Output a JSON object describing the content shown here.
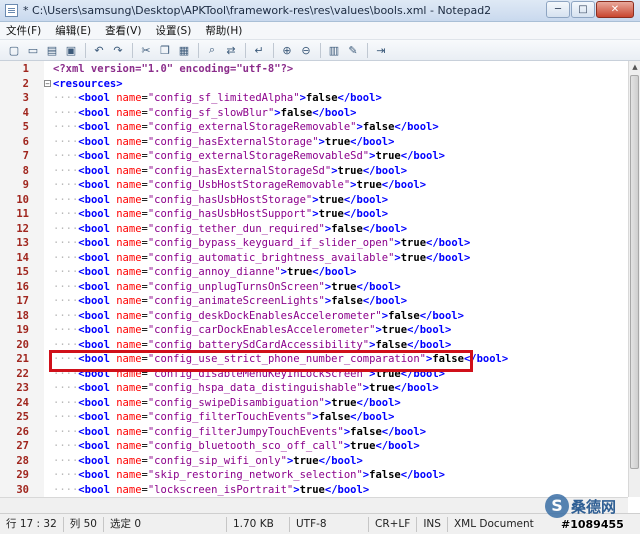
{
  "window": {
    "title": "* C:\\Users\\samsung\\Desktop\\APKTool\\framework-res\\res\\values\\bools.xml - Notepad2",
    "buttons": {
      "minimize": "─",
      "maximize": "□",
      "close": "✕"
    }
  },
  "menu": [
    "文件(F)",
    "编辑(E)",
    "查看(V)",
    "设置(S)",
    "帮助(H)"
  ],
  "toolbar": [
    "new-icon",
    "open-icon",
    "browse-icon",
    "save-icon",
    "undo-icon",
    "redo-icon",
    "cut-icon",
    "copy-icon",
    "paste-icon",
    "find-icon",
    "replace-icon",
    "wordwrap-icon",
    "zoom-in-icon",
    "zoom-out-icon",
    "scheme-icon",
    "customize-icon",
    "exit-icon"
  ],
  "editor": {
    "lines": [
      {
        "n": "1",
        "k": "pi",
        "text": "<?xml version=\"1.0\" encoding=\"utf-8\"?>"
      },
      {
        "n": "2",
        "k": "open",
        "text": "<resources>"
      },
      {
        "n": "3",
        "name": "config_sf_limitedAlpha",
        "value": "false"
      },
      {
        "n": "4",
        "name": "config_sf_slowBlur",
        "value": "false"
      },
      {
        "n": "5",
        "name": "config_externalStorageRemovable",
        "value": "false"
      },
      {
        "n": "6",
        "name": "config_hasExternalStorage",
        "value": "true"
      },
      {
        "n": "7",
        "name": "config_externalStorageRemovableSd",
        "value": "true"
      },
      {
        "n": "8",
        "name": "config_hasExternalStorageSd",
        "value": "true"
      },
      {
        "n": "9",
        "name": "config_UsbHostStorageRemovable",
        "value": "true"
      },
      {
        "n": "10",
        "name": "config_hasUsbHostStorage",
        "value": "true"
      },
      {
        "n": "11",
        "name": "config_hasUsbHostSupport",
        "value": "true"
      },
      {
        "n": "12",
        "name": "config_tether_dun_required",
        "value": "false"
      },
      {
        "n": "13",
        "name": "config_bypass_keyguard_if_slider_open",
        "value": "true"
      },
      {
        "n": "14",
        "name": "config_automatic_brightness_available",
        "value": "true"
      },
      {
        "n": "15",
        "name": "config_annoy_dianne",
        "value": "true"
      },
      {
        "n": "16",
        "name": "config_unplugTurnsOnScreen",
        "value": "true"
      },
      {
        "n": "17",
        "name": "config_animateScreenLights",
        "value": "false"
      },
      {
        "n": "18",
        "name": "config_deskDockEnablesAccelerometer",
        "value": "false"
      },
      {
        "n": "19",
        "name": "config_carDockEnablesAccelerometer",
        "value": "true"
      },
      {
        "n": "20",
        "name": "config_batterySdCardAccessibility",
        "value": "false"
      },
      {
        "n": "21",
        "name": "config_use_strict_phone_number_comparation",
        "value": "false"
      },
      {
        "n": "22",
        "name": "config_disableMenuKeyInLockScreen",
        "value": "true"
      },
      {
        "n": "23",
        "name": "config_hspa_data_distinguishable",
        "value": "true"
      },
      {
        "n": "24",
        "name": "config_swipeDisambiguation",
        "value": "true"
      },
      {
        "n": "25",
        "name": "config_filterTouchEvents",
        "value": "false"
      },
      {
        "n": "26",
        "name": "config_filterJumpyTouchEvents",
        "value": "false"
      },
      {
        "n": "27",
        "name": "config_bluetooth_sco_off_call",
        "value": "true"
      },
      {
        "n": "28",
        "name": "config_sip_wifi_only",
        "value": "true"
      },
      {
        "n": "29",
        "name": "skip_restoring_network_selection",
        "value": "false"
      },
      {
        "n": "30",
        "name": "lockscreen_isPortrait",
        "value": "true"
      }
    ]
  },
  "status": {
    "position": "行 17 : 32",
    "column": "列 50",
    "selection": "选定 0",
    "size": "1.70 KB",
    "encoding": "UTF-8",
    "eol": "CR+LF",
    "mode": "INS",
    "scheme": "XML Document"
  },
  "watermark": {
    "logo": "S",
    "name": "桑德网",
    "id": "#1089455"
  },
  "colors": {
    "highlight": "#d0101a",
    "line_number": "#a0261e",
    "tag": "#0000ff",
    "attr": "#ff0000",
    "value": "#8b008b"
  }
}
